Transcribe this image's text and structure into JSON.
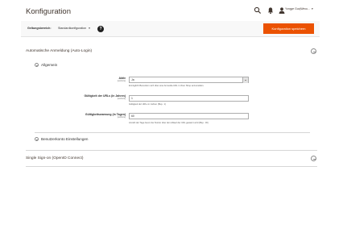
{
  "header": {
    "title": "Konfiguration",
    "user_name": "Yongye Guo|Wecu...",
    "user_caret": "▾",
    "icons": [
      "search-icon",
      "bell-icon",
      "user-icon"
    ]
  },
  "scope_bar": {
    "label": "Geltungsbereich:",
    "scope_value": "Standardkonfiguration",
    "caret": "▾",
    "help": "?",
    "save_label": "Konfiguration speichern"
  },
  "section_auto_login": {
    "title": "Automatische Anmeldung (Auto-Login)",
    "group_general": {
      "title": "Allgemein",
      "fields": [
        {
          "label": "Aktiv",
          "scope": "[website]",
          "value": "Ja",
          "note": "Ermöglicht Benutzern sich über eine Anmelde-URL in ihren Shop anzumelden."
        },
        {
          "label": "Gültigkeit der URLs (in Jahren)",
          "scope": "[website]",
          "value": "1",
          "note": "Gültigkeit der URLs in Jahren (Bsp.: 1)"
        },
        {
          "label": "Gültigkeitswarnung (in Tagen)",
          "scope": "[website]",
          "value": "60",
          "note": "Anzahl der Tage bevor der Nutzer über den Ablauf der URL gewarnt wird (Bsp.: 30)"
        }
      ]
    },
    "group_user_accounts": {
      "title": "Benutzerkonto Einstellungen"
    }
  },
  "section_sso": {
    "title": "Single Sign-on (OpenID Connect)"
  },
  "colors": {
    "accent": "#eb5202",
    "text": "#41362f",
    "help_bg": "#1f1f1f"
  }
}
